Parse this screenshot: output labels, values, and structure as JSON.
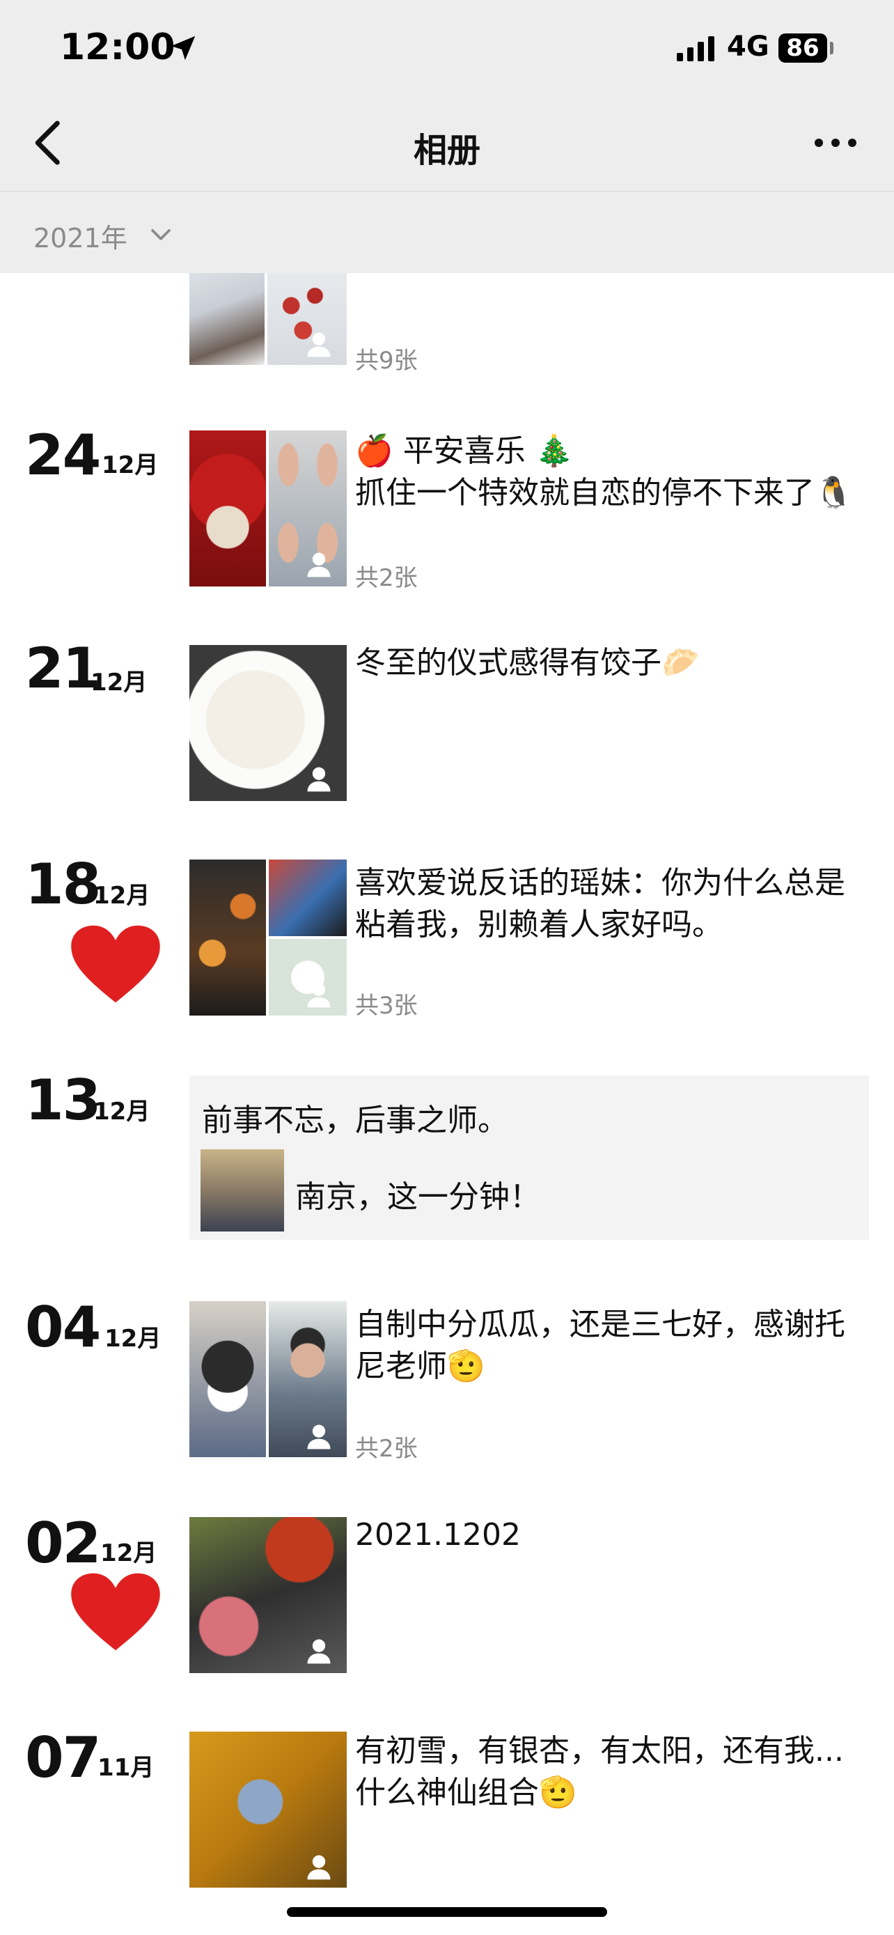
{
  "status_bar": {
    "time": "12:00",
    "network": "4G",
    "battery": "86"
  },
  "nav": {
    "title": "相册"
  },
  "year_filter": {
    "label": "2021年"
  },
  "posts": [
    {
      "count": "共9张"
    },
    {
      "day": "24",
      "month": "12月",
      "text": "🍎 平安喜乐 🎄\n抓住一个特效就自恋的停不下来了🐧",
      "count": "共2张"
    },
    {
      "day": "21",
      "month": "12月",
      "text": "冬至的仪式感得有饺子🥟"
    },
    {
      "day": "18",
      "month": "12月",
      "text": "喜欢爱说反话的瑶妹：你为什么总是粘着我，别赖着人家好吗。",
      "count": "共3张"
    },
    {
      "day": "13",
      "month": "12月",
      "text": "前事不忘，后事之师。",
      "shared_title": "南京，这一分钟！"
    },
    {
      "day": "04",
      "month": "12月",
      "text": "自制中分瓜瓜，还是三七好，感谢托尼老师🫡",
      "count": "共2张"
    },
    {
      "day": "02",
      "month": "12月",
      "text": "2021.1202"
    },
    {
      "day": "07",
      "month": "11月",
      "text": "有初雪，有银杏，有太阳，还有我...\n什么神仙组合🫡"
    }
  ],
  "colors": {
    "header_bg": "#ededed",
    "muted_text": "#8a8a8a",
    "heart": "#e02020",
    "shared_bg": "#f3f3f3"
  }
}
